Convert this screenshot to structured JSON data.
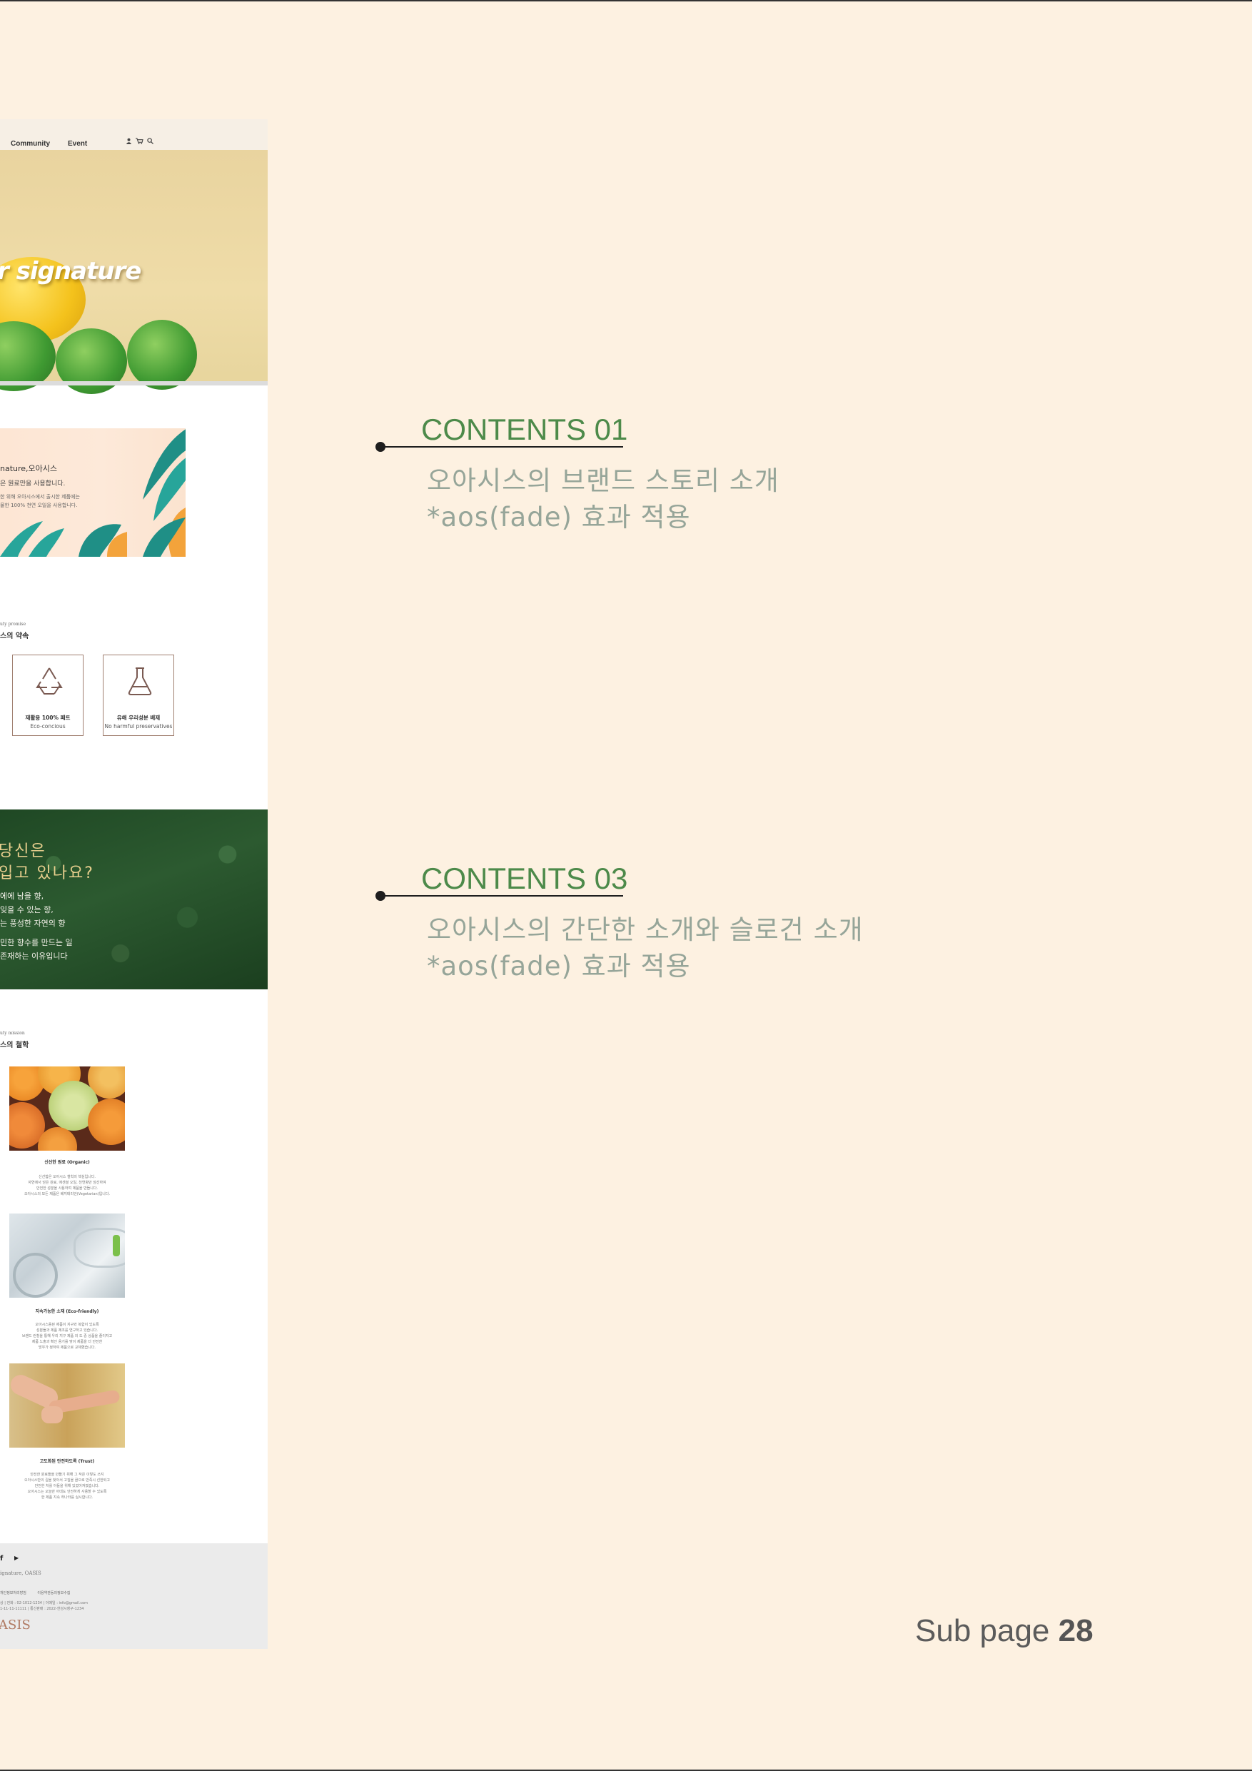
{
  "mockup": {
    "nav": {
      "items": [
        "Community",
        "Event"
      ],
      "icons": [
        "user-icon",
        "cart-icon",
        "search-icon"
      ]
    },
    "hero": {
      "headline": "r signature"
    },
    "brand_story": {
      "title": "nature,오아시스",
      "subtitle": "은 원료만을 사용합니다.",
      "body_lines": [
        "한 위해 오아시스에서 출시한 제품에는",
        "물한 100% 천연 오일을 사용합니다."
      ]
    },
    "promise": {
      "subtitle": "uty promise",
      "title": "스의 약속",
      "cards": [
        {
          "ko": "재활용 100% 패트",
          "en": "Eco-concious",
          "icon": "recycle-icon"
        },
        {
          "ko": "유해 우리성분 배제",
          "en": "No harmful preservatives",
          "icon": "flask-icon"
        }
      ]
    },
    "forest": {
      "line1": "당신은",
      "line2": "입고 있나요?",
      "para1": [
        "에에 남을 향,",
        "잊을 수 있는 향,",
        "는 풍성한 자연의 향"
      ],
      "para2": [
        "민한 향수를 만드는 일",
        "존재하는 이유입니다"
      ]
    },
    "philosophy": {
      "subtitle": "uty mission",
      "title": "스의 철학",
      "items": [
        {
          "caption": "신선한 원료 (Organic)",
          "lines": [
            "신선함은 오아시스 철학의 핵심입니다.",
            "자연에서 얻은 원료, 에센셜 오일, 천연향만 엄선하여",
            "안전한 성분을 사용하여 제품을 만듭니다.",
            "오아시스의 모든 제품은 베지테리언(Vegetarian)입니다."
          ]
        },
        {
          "caption": "지속가능한 소재 (Eco-friendly)",
          "lines": [
            "오아시스용된 제품이 지구와 복합이 있도록",
            "성분들과 제품 제조를 연구하고 있습니다.",
            "브랜드 런칭을 통해 우리 지구 제품 의 도 중 상품을 줄이자고",
            "제품 노출과 확인 용기를 맞이 제품을 더 안전한",
            "방우가 정하여 제품으로 교체했습니다."
          ]
        },
        {
          "caption": "고도화된 안전하도록 (Trust)",
          "lines": [
            "안전한 원료들을 만들기 위해 그 작은 이렇도 쓰지",
            "오아시스만의 길을 찾아서 고집을 꿈으로 만족시 선한되고",
            "안전한 처를 아들을 위해 있었어져였습니다.",
            "오아시스는 오늘만 아대도 안전하게 사용할 수 있도록",
            "한 제품 지속 하나라를 실시합니다."
          ]
        }
      ]
    },
    "footer": {
      "social": [
        "f",
        "▶"
      ],
      "copyright": "ignature, OASIS",
      "links": [
        "개인정보처리방침",
        "이용약관동의정보수집"
      ],
      "info_lines": [
        "상 | 전화 : 02-1012-1234 | 이메일 : info@gmail.com",
        "1-11-11-11111 | 통신판매 : 2022-한성시청구-1234"
      ],
      "logo": "ASIS"
    }
  },
  "annotations": [
    {
      "heading": "CONTENTS 01",
      "lines": [
        "오아시스의 브랜드 스토리 소개",
        "*aos(fade) 효과 적용"
      ]
    },
    {
      "heading": "CONTENTS 03",
      "lines": [
        "오아시스의 간단한 소개와 슬로건 소개",
        "*aos(fade) 효과 적용"
      ]
    }
  ],
  "page_footer": {
    "label": "Sub page",
    "number": "28"
  },
  "colors": {
    "background": "#fdf1e1",
    "heading_green": "#4d8a4a",
    "desc_gray": "#96a599"
  }
}
